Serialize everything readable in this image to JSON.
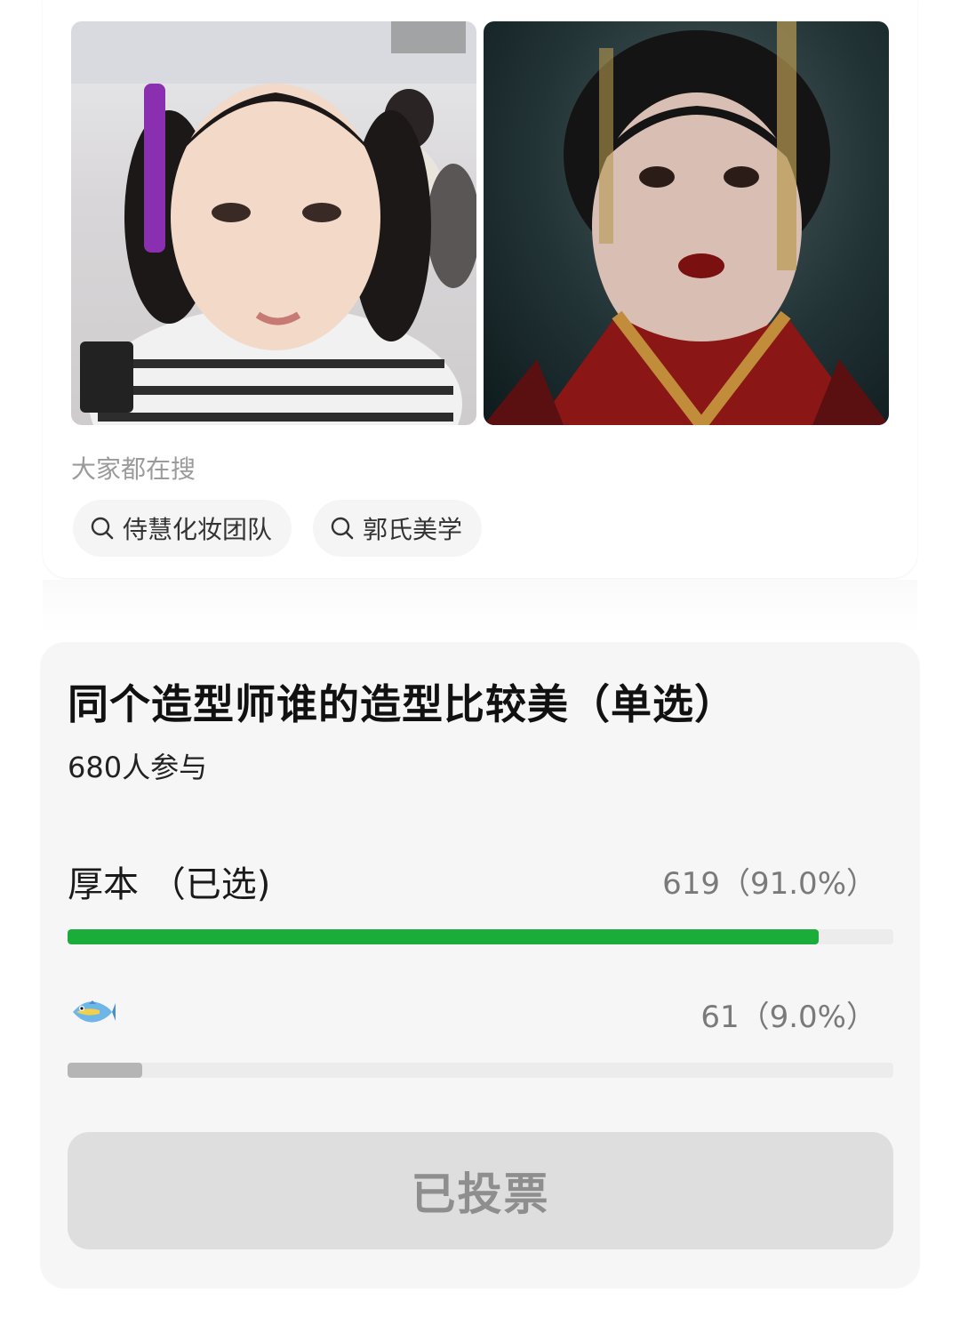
{
  "search_suggestions": {
    "caption": "大家都在搜",
    "items": [
      {
        "label": "侍慧化妆团队",
        "icon": "search-icon"
      },
      {
        "label": "郭氏美学",
        "icon": "search-icon"
      }
    ]
  },
  "photos": [
    {
      "name": "makeup-artist-selfie",
      "description_icon": "photo"
    },
    {
      "name": "period-drama-still",
      "description_icon": "photo"
    }
  ],
  "poll": {
    "title": "同个造型师谁的造型比较美（单选）",
    "participants": "680人参与",
    "options": [
      {
        "label": "厚本 （已选)",
        "count_text": "619（91.0%）",
        "fraction": 0.91,
        "color": "#1aad3a",
        "selected": true
      },
      {
        "label_icon": "fish-icon",
        "count_text": "61（9.0%）",
        "fraction": 0.09,
        "color": "#b5b5b5",
        "selected": false
      }
    ],
    "voted_label": "已投票"
  }
}
